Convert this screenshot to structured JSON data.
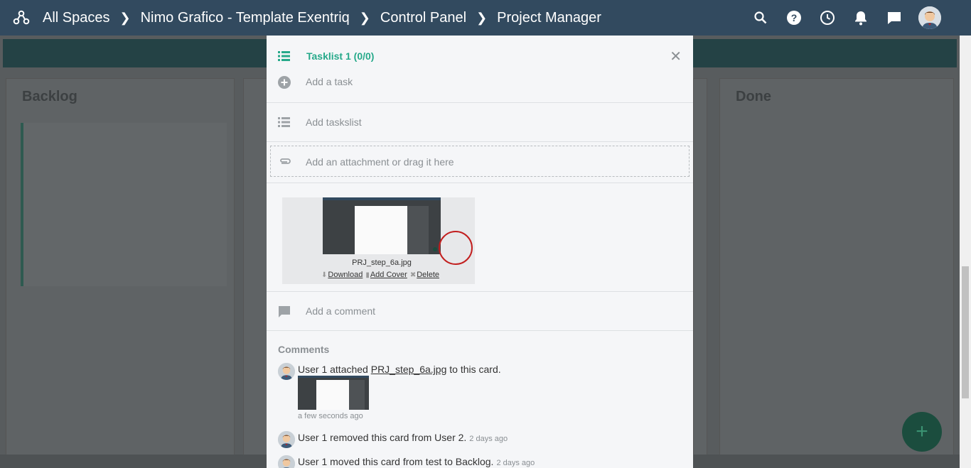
{
  "topbar": {
    "breadcrumbs": [
      "All Spaces",
      "Nimo Grafico - Template Exentriq",
      "Control Panel",
      "Project Manager"
    ],
    "icons": [
      "search-icon",
      "help-icon",
      "clock-icon",
      "bell-icon",
      "chat-icon",
      "user-avatar"
    ]
  },
  "board": {
    "columns": [
      "Backlog",
      "Done"
    ]
  },
  "panel": {
    "tasklist": {
      "title": "Tasklist 1 (0/0)",
      "add_task": "Add a task"
    },
    "add_tasklist": "Add taskslist",
    "attachment": {
      "placeholder": "Add an attachment or drag it here",
      "file_name": "PRJ_step_6a.jpg",
      "actions": [
        "Download",
        "Add Cover",
        "Delete"
      ]
    },
    "comment_placeholder": "Add a comment",
    "comments": {
      "heading": "Comments",
      "items": [
        {
          "pre": "User 1 attached ",
          "link": "PRJ_step_6a.jpg",
          "post": " to this card.",
          "ago": "a few seconds ago"
        },
        {
          "text": "User 1 removed this card from User 2.",
          "ago": "2 days ago"
        },
        {
          "text": "User 1 moved this card from test to Backlog.",
          "ago": "2 days ago"
        }
      ]
    }
  },
  "colors": {
    "topbar": "#324a5f",
    "accent": "#26a98a",
    "marker": "#c21f1f"
  }
}
